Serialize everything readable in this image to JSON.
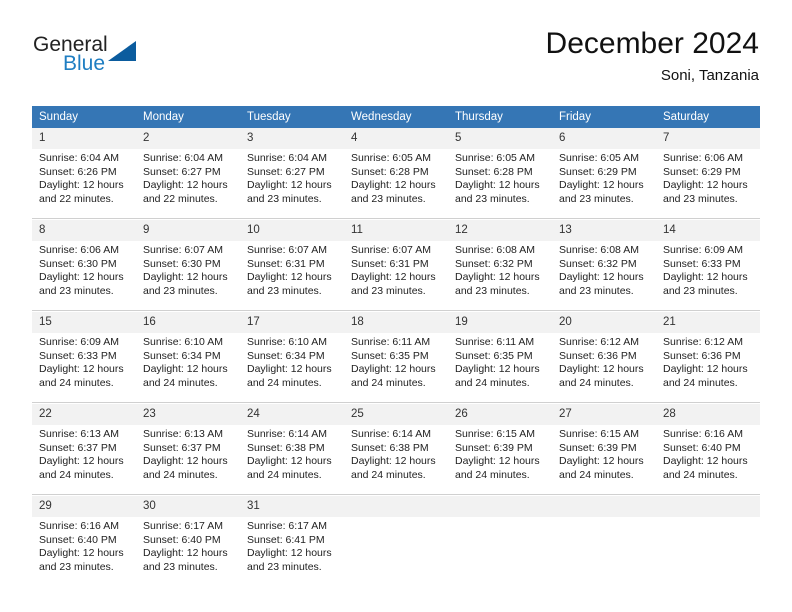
{
  "brand": {
    "name_part1": "General",
    "name_part2": "Blue"
  },
  "header": {
    "title": "December 2024",
    "subtitle": "Soni, Tanzania"
  },
  "calendar": {
    "weekday_headers": [
      "Sunday",
      "Monday",
      "Tuesday",
      "Wednesday",
      "Thursday",
      "Friday",
      "Saturday"
    ],
    "accent_color": "#3576b5",
    "daynum_bg": "#f2f2f2",
    "weeks": [
      [
        {
          "day": "1",
          "sunrise": "Sunrise: 6:04 AM",
          "sunset": "Sunset: 6:26 PM",
          "daylight1": "Daylight: 12 hours",
          "daylight2": "and 22 minutes."
        },
        {
          "day": "2",
          "sunrise": "Sunrise: 6:04 AM",
          "sunset": "Sunset: 6:27 PM",
          "daylight1": "Daylight: 12 hours",
          "daylight2": "and 22 minutes."
        },
        {
          "day": "3",
          "sunrise": "Sunrise: 6:04 AM",
          "sunset": "Sunset: 6:27 PM",
          "daylight1": "Daylight: 12 hours",
          "daylight2": "and 23 minutes."
        },
        {
          "day": "4",
          "sunrise": "Sunrise: 6:05 AM",
          "sunset": "Sunset: 6:28 PM",
          "daylight1": "Daylight: 12 hours",
          "daylight2": "and 23 minutes."
        },
        {
          "day": "5",
          "sunrise": "Sunrise: 6:05 AM",
          "sunset": "Sunset: 6:28 PM",
          "daylight1": "Daylight: 12 hours",
          "daylight2": "and 23 minutes."
        },
        {
          "day": "6",
          "sunrise": "Sunrise: 6:05 AM",
          "sunset": "Sunset: 6:29 PM",
          "daylight1": "Daylight: 12 hours",
          "daylight2": "and 23 minutes."
        },
        {
          "day": "7",
          "sunrise": "Sunrise: 6:06 AM",
          "sunset": "Sunset: 6:29 PM",
          "daylight1": "Daylight: 12 hours",
          "daylight2": "and 23 minutes."
        }
      ],
      [
        {
          "day": "8",
          "sunrise": "Sunrise: 6:06 AM",
          "sunset": "Sunset: 6:30 PM",
          "daylight1": "Daylight: 12 hours",
          "daylight2": "and 23 minutes."
        },
        {
          "day": "9",
          "sunrise": "Sunrise: 6:07 AM",
          "sunset": "Sunset: 6:30 PM",
          "daylight1": "Daylight: 12 hours",
          "daylight2": "and 23 minutes."
        },
        {
          "day": "10",
          "sunrise": "Sunrise: 6:07 AM",
          "sunset": "Sunset: 6:31 PM",
          "daylight1": "Daylight: 12 hours",
          "daylight2": "and 23 minutes."
        },
        {
          "day": "11",
          "sunrise": "Sunrise: 6:07 AM",
          "sunset": "Sunset: 6:31 PM",
          "daylight1": "Daylight: 12 hours",
          "daylight2": "and 23 minutes."
        },
        {
          "day": "12",
          "sunrise": "Sunrise: 6:08 AM",
          "sunset": "Sunset: 6:32 PM",
          "daylight1": "Daylight: 12 hours",
          "daylight2": "and 23 minutes."
        },
        {
          "day": "13",
          "sunrise": "Sunrise: 6:08 AM",
          "sunset": "Sunset: 6:32 PM",
          "daylight1": "Daylight: 12 hours",
          "daylight2": "and 23 minutes."
        },
        {
          "day": "14",
          "sunrise": "Sunrise: 6:09 AM",
          "sunset": "Sunset: 6:33 PM",
          "daylight1": "Daylight: 12 hours",
          "daylight2": "and 23 minutes."
        }
      ],
      [
        {
          "day": "15",
          "sunrise": "Sunrise: 6:09 AM",
          "sunset": "Sunset: 6:33 PM",
          "daylight1": "Daylight: 12 hours",
          "daylight2": "and 24 minutes."
        },
        {
          "day": "16",
          "sunrise": "Sunrise: 6:10 AM",
          "sunset": "Sunset: 6:34 PM",
          "daylight1": "Daylight: 12 hours",
          "daylight2": "and 24 minutes."
        },
        {
          "day": "17",
          "sunrise": "Sunrise: 6:10 AM",
          "sunset": "Sunset: 6:34 PM",
          "daylight1": "Daylight: 12 hours",
          "daylight2": "and 24 minutes."
        },
        {
          "day": "18",
          "sunrise": "Sunrise: 6:11 AM",
          "sunset": "Sunset: 6:35 PM",
          "daylight1": "Daylight: 12 hours",
          "daylight2": "and 24 minutes."
        },
        {
          "day": "19",
          "sunrise": "Sunrise: 6:11 AM",
          "sunset": "Sunset: 6:35 PM",
          "daylight1": "Daylight: 12 hours",
          "daylight2": "and 24 minutes."
        },
        {
          "day": "20",
          "sunrise": "Sunrise: 6:12 AM",
          "sunset": "Sunset: 6:36 PM",
          "daylight1": "Daylight: 12 hours",
          "daylight2": "and 24 minutes."
        },
        {
          "day": "21",
          "sunrise": "Sunrise: 6:12 AM",
          "sunset": "Sunset: 6:36 PM",
          "daylight1": "Daylight: 12 hours",
          "daylight2": "and 24 minutes."
        }
      ],
      [
        {
          "day": "22",
          "sunrise": "Sunrise: 6:13 AM",
          "sunset": "Sunset: 6:37 PM",
          "daylight1": "Daylight: 12 hours",
          "daylight2": "and 24 minutes."
        },
        {
          "day": "23",
          "sunrise": "Sunrise: 6:13 AM",
          "sunset": "Sunset: 6:37 PM",
          "daylight1": "Daylight: 12 hours",
          "daylight2": "and 24 minutes."
        },
        {
          "day": "24",
          "sunrise": "Sunrise: 6:14 AM",
          "sunset": "Sunset: 6:38 PM",
          "daylight1": "Daylight: 12 hours",
          "daylight2": "and 24 minutes."
        },
        {
          "day": "25",
          "sunrise": "Sunrise: 6:14 AM",
          "sunset": "Sunset: 6:38 PM",
          "daylight1": "Daylight: 12 hours",
          "daylight2": "and 24 minutes."
        },
        {
          "day": "26",
          "sunrise": "Sunrise: 6:15 AM",
          "sunset": "Sunset: 6:39 PM",
          "daylight1": "Daylight: 12 hours",
          "daylight2": "and 24 minutes."
        },
        {
          "day": "27",
          "sunrise": "Sunrise: 6:15 AM",
          "sunset": "Sunset: 6:39 PM",
          "daylight1": "Daylight: 12 hours",
          "daylight2": "and 24 minutes."
        },
        {
          "day": "28",
          "sunrise": "Sunrise: 6:16 AM",
          "sunset": "Sunset: 6:40 PM",
          "daylight1": "Daylight: 12 hours",
          "daylight2": "and 24 minutes."
        }
      ],
      [
        {
          "day": "29",
          "sunrise": "Sunrise: 6:16 AM",
          "sunset": "Sunset: 6:40 PM",
          "daylight1": "Daylight: 12 hours",
          "daylight2": "and 23 minutes."
        },
        {
          "day": "30",
          "sunrise": "Sunrise: 6:17 AM",
          "sunset": "Sunset: 6:40 PM",
          "daylight1": "Daylight: 12 hours",
          "daylight2": "and 23 minutes."
        },
        {
          "day": "31",
          "sunrise": "Sunrise: 6:17 AM",
          "sunset": "Sunset: 6:41 PM",
          "daylight1": "Daylight: 12 hours",
          "daylight2": "and 23 minutes."
        },
        {
          "day": "",
          "sunrise": "",
          "sunset": "",
          "daylight1": "",
          "daylight2": ""
        },
        {
          "day": "",
          "sunrise": "",
          "sunset": "",
          "daylight1": "",
          "daylight2": ""
        },
        {
          "day": "",
          "sunrise": "",
          "sunset": "",
          "daylight1": "",
          "daylight2": ""
        },
        {
          "day": "",
          "sunrise": "",
          "sunset": "",
          "daylight1": "",
          "daylight2": ""
        }
      ]
    ]
  }
}
